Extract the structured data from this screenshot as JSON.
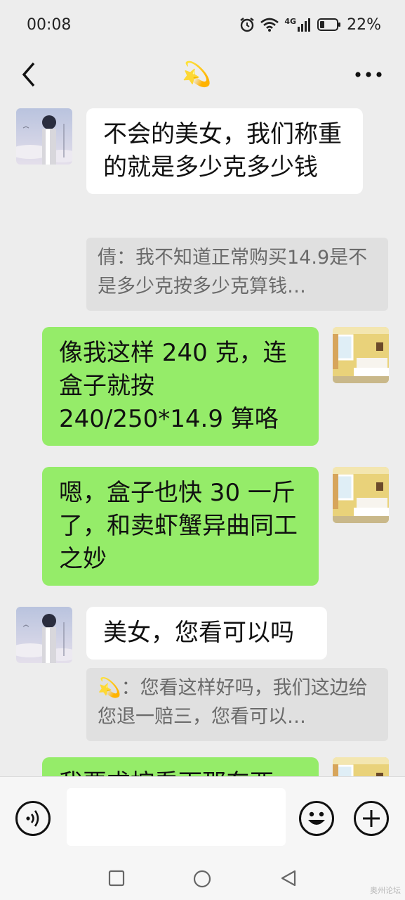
{
  "status_bar": {
    "time": "00:08",
    "network": "4G",
    "battery": "22%"
  },
  "header": {
    "back_icon": "chevron-left-icon",
    "title_emoji": "💫",
    "more_icon": "more-dots-icon"
  },
  "messages": [
    {
      "side": "in",
      "text": "不会的美女，我们称重的就是多少克多少钱"
    },
    {
      "side": "quote",
      "text": "倩：我不知道正常购买14.9是不是多少克按多少克算钱…"
    },
    {
      "side": "out",
      "text": "像我这样 240 克，连盒子就按 240/250*14.9 算咯"
    },
    {
      "side": "out",
      "text": "嗯，盒子也快 30 一斤了，和卖虾蟹异曲同工之妙"
    },
    {
      "side": "in",
      "text": "美女，您看可以吗"
    },
    {
      "side": "quote",
      "text": "💫：您看这样好吗，我们这边给您退一赔三，您看可以…"
    },
    {
      "side": "out",
      "text": "我要求按看下那东西"
    }
  ],
  "input_bar": {
    "voice_icon": "voice-icon",
    "emoji_icon": "emoji-icon",
    "plus_icon": "plus-icon"
  },
  "watermark": "奥州论坛"
}
